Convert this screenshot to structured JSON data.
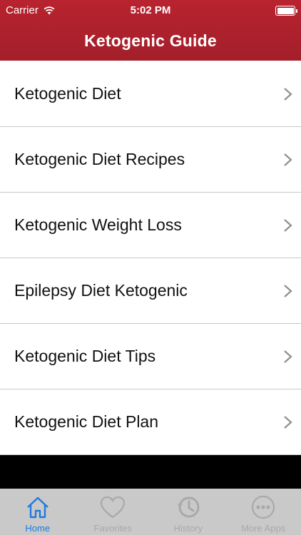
{
  "status_bar": {
    "carrier": "Carrier",
    "time": "5:02 PM",
    "wifi_icon": "wifi-icon",
    "battery_icon": "battery-icon"
  },
  "nav": {
    "title": "Ketogenic Guide"
  },
  "list": {
    "items": [
      {
        "label": "Ketogenic Diet"
      },
      {
        "label": "Ketogenic Diet Recipes"
      },
      {
        "label": "Ketogenic Weight Loss"
      },
      {
        "label": "Epilepsy Diet Ketogenic"
      },
      {
        "label": "Ketogenic Diet Tips"
      },
      {
        "label": "Ketogenic Diet Plan"
      }
    ],
    "chevron_icon": "chevron-right-icon"
  },
  "tabbar": {
    "tabs": [
      {
        "label": "Home",
        "icon": "home-icon",
        "active": true
      },
      {
        "label": "Favorites",
        "icon": "heart-icon",
        "active": false
      },
      {
        "label": "History",
        "icon": "history-clock-icon",
        "active": false
      },
      {
        "label": "More Apps",
        "icon": "more-dots-icon",
        "active": false
      }
    ]
  },
  "colors": {
    "header": "#b8232f",
    "tab_active": "#1f7ae0",
    "tab_inactive": "#a9a9a9",
    "tabbar_bg": "#c9c9c9"
  }
}
